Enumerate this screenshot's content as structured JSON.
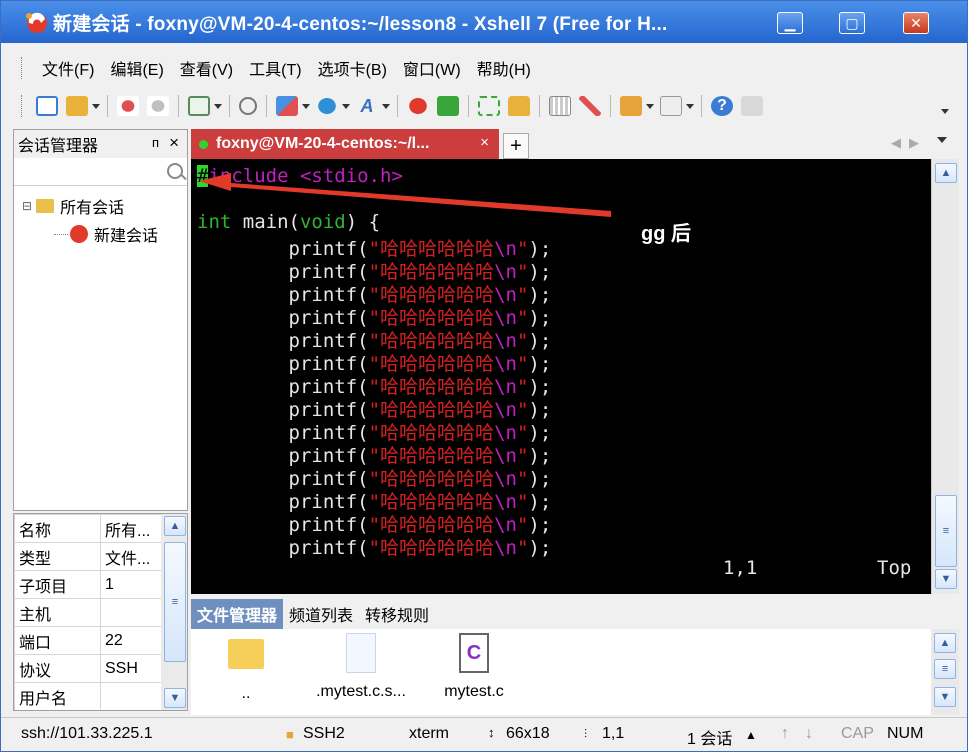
{
  "window": {
    "title": "新建会话 - foxny@VM-20-4-centos:~/lesson8 - Xshell 7 (Free for H...",
    "accent": "#2566cf"
  },
  "menu": [
    "文件(F)",
    "编辑(E)",
    "查看(V)",
    "工具(T)",
    "选项卡(B)",
    "窗口(W)",
    "帮助(H)"
  ],
  "session_manager": {
    "title": "会话管理器",
    "pin": "ᴨ",
    "close": "×",
    "search_placeholder": "",
    "tree": {
      "root": {
        "expander": "⊟",
        "label": "所有会话"
      },
      "child": {
        "label": "新建会话"
      }
    }
  },
  "properties": [
    {
      "key": "名称",
      "value": "所有..."
    },
    {
      "key": "类型",
      "value": "文件..."
    },
    {
      "key": "子项目",
      "value": "1"
    },
    {
      "key": "主机",
      "value": ""
    },
    {
      "key": "端口",
      "value": "22"
    },
    {
      "key": "协议",
      "value": "SSH"
    },
    {
      "key": "用户名",
      "value": ""
    }
  ],
  "tab": {
    "label": "foxny@VM-20-4-centos:~/l...",
    "close": "×",
    "add": "+"
  },
  "terminal": {
    "include_hash": "#",
    "include_kw": "include",
    "include_file": " <stdio.h>",
    "main_int": "int",
    "main_name": " main(",
    "main_void": "void",
    "main_rest": ") {",
    "printf_indent": "        printf(",
    "printf_quote_open": "\"",
    "printf_text": "哈哈哈哈哈哈",
    "printf_escape": "\\n",
    "printf_quote_close": "\"",
    "printf_end": ");",
    "printf_count": 14,
    "cursor_pos": "1,1",
    "scroll_pos": "Top",
    "annotation": "gg 后"
  },
  "file_manager": {
    "tabs": [
      "文件管理器",
      "频道列表",
      "转移规则"
    ],
    "items": [
      {
        "name": "..",
        "icon": "folder-icon"
      },
      {
        "name": ".mytest.c.s...",
        "icon": "file-icon"
      },
      {
        "name": "mytest.c",
        "icon": "c-file-icon"
      }
    ]
  },
  "status": {
    "address": "ssh://101.33.225.1",
    "protocol": "SSH2",
    "term_type": "xterm",
    "size": "66x18",
    "position": "1,1",
    "sessions": "1 会话",
    "cap": "CAP",
    "num": "NUM"
  }
}
